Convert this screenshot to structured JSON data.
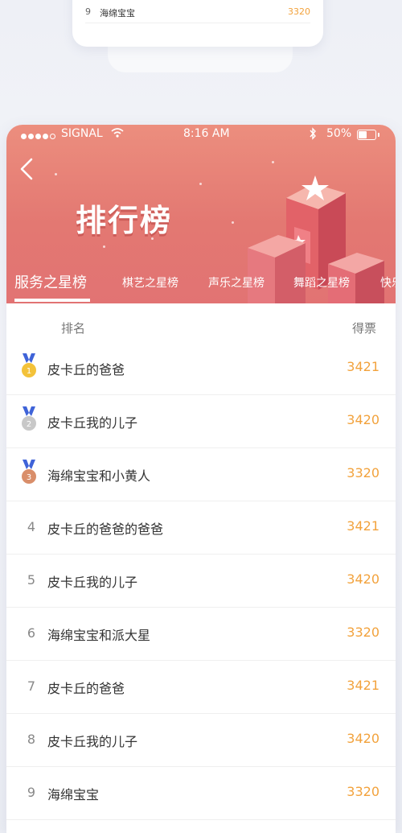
{
  "background_card": {
    "rank": "9",
    "name": "海绵宝宝",
    "score": "3320"
  },
  "status_bar": {
    "carrier": "SIGNAL",
    "time": "8:16 AM",
    "battery": "50%"
  },
  "header": {
    "title": "排行榜"
  },
  "tabs": [
    {
      "label": "服务之星榜",
      "active": true
    },
    {
      "label": "棋艺之星榜"
    },
    {
      "label": "声乐之星榜"
    },
    {
      "label": "舞蹈之星榜"
    },
    {
      "label": "快乐"
    }
  ],
  "columns": {
    "rank": "排名",
    "votes": "得票"
  },
  "rows": [
    {
      "rank": "1",
      "name": "皮卡丘的爸爸",
      "score": "3421"
    },
    {
      "rank": "2",
      "name": "皮卡丘我的儿子",
      "score": "3420"
    },
    {
      "rank": "3",
      "name": "海绵宝宝和小黄人",
      "score": "3320"
    },
    {
      "rank": "4",
      "name": "皮卡丘的爸爸的爸爸",
      "score": "3421"
    },
    {
      "rank": "5",
      "name": "皮卡丘我的儿子",
      "score": "3420"
    },
    {
      "rank": "6",
      "name": "海绵宝宝和派大星",
      "score": "3320"
    },
    {
      "rank": "7",
      "name": "皮卡丘的爸爸",
      "score": "3421"
    },
    {
      "rank": "8",
      "name": "皮卡丘我的儿子",
      "score": "3420"
    },
    {
      "rank": "9",
      "name": "海绵宝宝",
      "score": "3320"
    }
  ],
  "colors": {
    "header": "#e47b74",
    "score": "#f2a23c",
    "gold": "#f3c23a",
    "silver": "#c8c8c8",
    "bronze": "#d98e6a",
    "ribbon": "#3f63d8"
  },
  "icons": [
    "back-arrow-icon",
    "wifi-icon",
    "bluetooth-icon",
    "battery-icon",
    "medal-gold-icon",
    "medal-silver-icon",
    "medal-bronze-icon"
  ]
}
